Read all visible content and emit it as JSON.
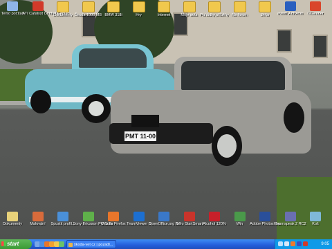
{
  "desktop": {
    "top_icons": [
      {
        "label": "Tento počítač",
        "icon": "computer-icon",
        "color": "#8fb6e8"
      },
      {
        "label": "ATI Catalyst Control Center",
        "icon": "ati-icon",
        "color": "#d23a2a"
      },
      {
        "label": "Dokumenty",
        "icon": "folder-icon",
        "color": "#f1c84d"
      },
      {
        "label": "Škoda 1000 MB",
        "icon": "folder-icon",
        "color": "#f1c84d"
      },
      {
        "label": "BMW 318i",
        "icon": "folder-icon",
        "color": "#f1c84d"
      },
      {
        "label": "Hry",
        "icon": "folder-icon",
        "color": "#f1c84d"
      },
      {
        "label": "Internet",
        "icon": "folder-icon",
        "color": "#f1c84d"
      },
      {
        "label": "Moje auta",
        "icon": "folder-icon",
        "color": "#f1c84d"
      },
      {
        "label": "Pohádky příběhy",
        "icon": "folder-icon",
        "color": "#f1c84d"
      },
      {
        "label": "Na forum",
        "icon": "folder-icon",
        "color": "#f1c84d"
      },
      {
        "label": "Jéňa",
        "icon": "folder-icon",
        "color": "#f1c84d"
      },
      {
        "label": "avast! Antivirus",
        "icon": "avast-icon",
        "color": "#2a5fbf"
      },
      {
        "label": "CCleaner",
        "icon": "ccleaner-icon",
        "color": "#d9452b"
      }
    ],
    "bottom_icons": [
      {
        "label": "Dokumenty",
        "icon": "documents-icon",
        "color": "#e8d27a"
      },
      {
        "label": "Malování",
        "icon": "paint-icon",
        "color": "#d86b3b"
      },
      {
        "label": "Spustit profil...",
        "icon": "profile-icon",
        "color": "#4a90d9"
      },
      {
        "label": "Sony Ericsson PC Suite",
        "icon": "sony-ericsson-icon",
        "color": "#5fb04a"
      },
      {
        "label": "Mozilla Firefox",
        "icon": "firefox-icon",
        "color": "#e8762b"
      },
      {
        "label": "TeamViewer 3",
        "icon": "teamviewer-icon",
        "color": "#1c6fd1"
      },
      {
        "label": "OpenOffice.org 3.0",
        "icon": "openoffice-icon",
        "color": "#3a78c8"
      },
      {
        "label": "Nero StartSmart",
        "icon": "nero-icon",
        "color": "#c9342b"
      },
      {
        "label": "Alcohol 120%",
        "icon": "alcohol-icon",
        "color": "#c8202a"
      },
      {
        "label": "Win",
        "icon": "win-icon",
        "color": "#4a9a4a"
      },
      {
        "label": "Adobe Photoshop",
        "icon": "photoshop-icon",
        "color": "#2a4f9a"
      },
      {
        "label": "Teamspeak 2 RC2",
        "icon": "teamspeak-icon",
        "color": "#6a6fb0"
      },
      {
        "label": "Koš",
        "icon": "recycle-bin-icon",
        "color": "#7fb8d8"
      }
    ],
    "license_plate": "PMT 11-00"
  },
  "taskbar": {
    "start_label": "start",
    "quick_launch": [
      {
        "icon": "show-desktop-icon",
        "color": "#7aa7e6"
      },
      {
        "icon": "ie-icon",
        "color": "#4f8fe0"
      },
      {
        "icon": "firefox-icon",
        "color": "#e8762b"
      },
      {
        "icon": "media-player-icon",
        "color": "#f0a030"
      },
      {
        "icon": "folder-icon",
        "color": "#f1c84d"
      },
      {
        "icon": "messenger-icon",
        "color": "#6bc26b"
      }
    ],
    "task_button": "škoda-vet cz | pozadí...",
    "tray_icons": [
      {
        "icon": "network-icon",
        "color": "#bfe3ff"
      },
      {
        "icon": "volume-icon",
        "color": "#d8e8f8"
      },
      {
        "icon": "avast-tray-icon",
        "color": "#f07a2a"
      },
      {
        "icon": "antivirus-tray-icon",
        "color": "#3a4fbf"
      },
      {
        "icon": "security-tray-icon",
        "color": "#d23a2a"
      }
    ],
    "clock": "9:05"
  }
}
